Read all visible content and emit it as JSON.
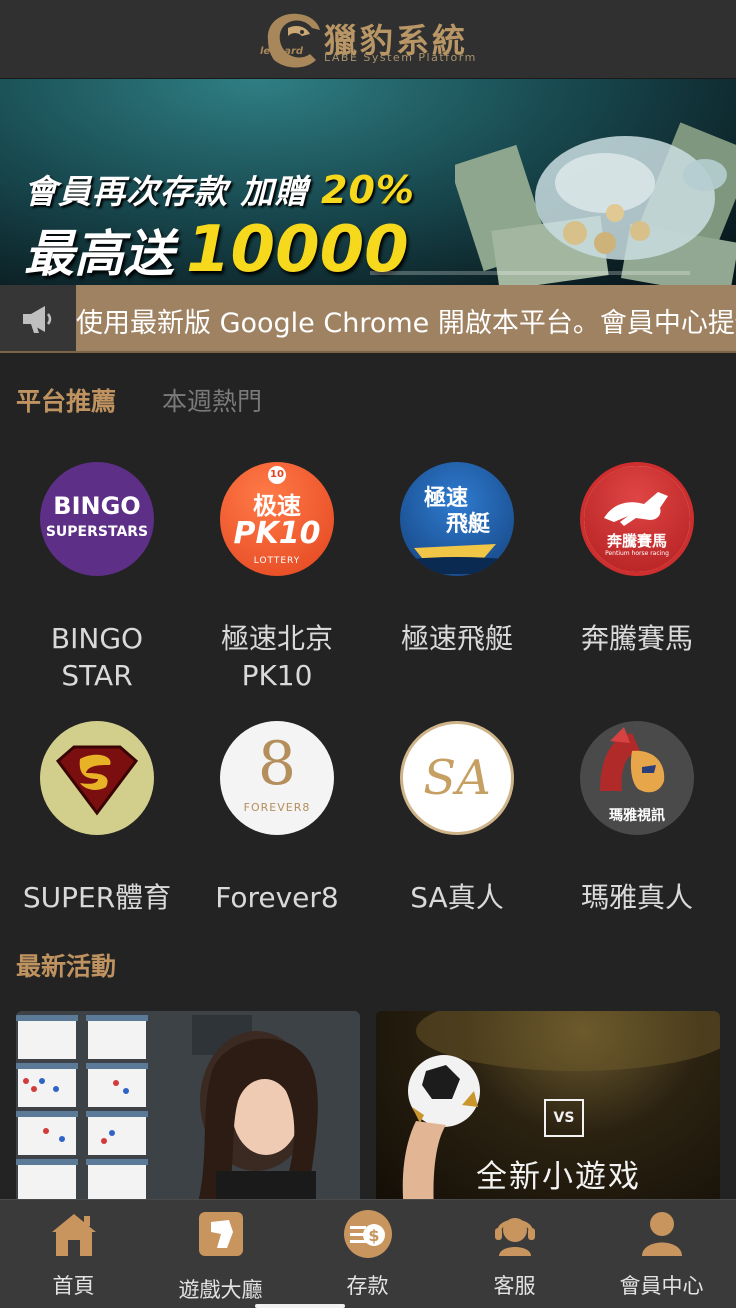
{
  "header": {
    "logo_title": "獵豹系統",
    "logo_subtitle": "LABE System Platform",
    "logo_badge": "leopard"
  },
  "banner": {
    "line1_text": "會員再次存款 加贈",
    "line1_highlight": "20%",
    "line2_text": "最高送",
    "line2_highlight": "10000"
  },
  "announcement": {
    "icon": "megaphone-icon",
    "text": "使用最新版 Google Chrome 開啟本平台。會員中心提供"
  },
  "tabs": [
    {
      "label": "平台推薦",
      "active": true
    },
    {
      "label": "本週熱門",
      "active": false
    }
  ],
  "games": [
    {
      "label": "BINGO\nSTAR",
      "icon_text_1": "BINGO",
      "icon_text_2": "SUPERSTARS"
    },
    {
      "label": "極速北京\nPK10",
      "icon_text_1": "极速",
      "icon_text_2": "PK10",
      "icon_text_3": "LOTTERY",
      "icon_text_4": "10"
    },
    {
      "label": "極速飛艇",
      "icon_text_1": "極速",
      "icon_text_2": "飛艇"
    },
    {
      "label": "奔騰賽馬",
      "icon_text_1": "奔騰賽馬",
      "icon_text_2": "Pentium horse racing"
    },
    {
      "label": "SUPER體育"
    },
    {
      "label": "Forever8",
      "icon_text_1": "FOREVER8"
    },
    {
      "label": "SA真人",
      "icon_text_1": "SA"
    },
    {
      "label": "瑪雅真人",
      "icon_text_1": "瑪雅視訊"
    }
  ],
  "section": {
    "latest_title": "最新活動"
  },
  "promos": [
    {
      "name": "baccarat-promo"
    },
    {
      "name": "mini-game-promo",
      "vs": "VS",
      "text": "全新小遊戏"
    }
  ],
  "bottom_nav": [
    {
      "label": "首頁",
      "icon": "home-icon"
    },
    {
      "label": "遊戲大廳",
      "icon": "game-lobby-icon"
    },
    {
      "label": "存款",
      "icon": "deposit-icon"
    },
    {
      "label": "客服",
      "icon": "customer-service-icon"
    },
    {
      "label": "會員中心",
      "icon": "member-icon"
    }
  ],
  "colors": {
    "accent_gold": "#bf9360",
    "marquee_bg": "#9f8262",
    "banner_yellow": "#f6d81c",
    "background": "#232323"
  }
}
